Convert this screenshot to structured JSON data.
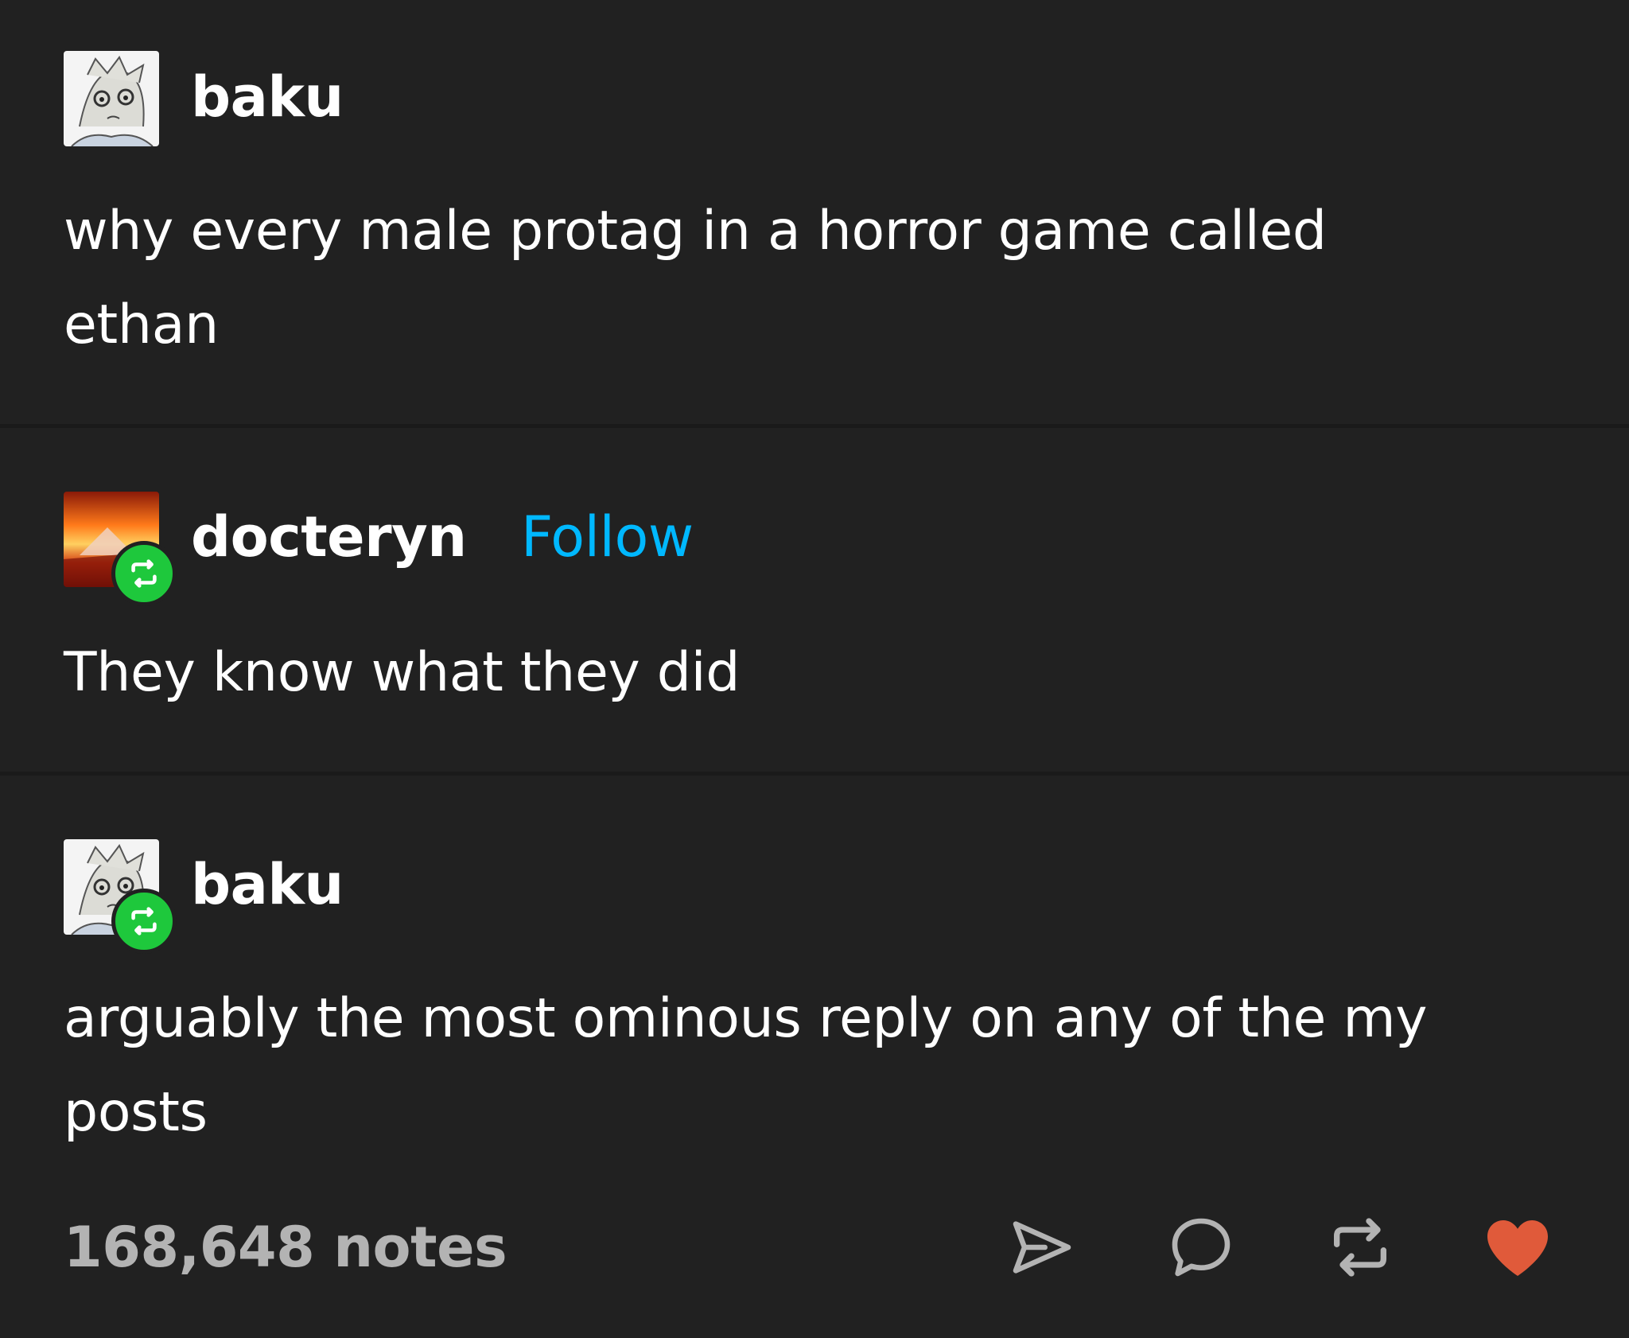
{
  "posts": [
    {
      "username": "baku",
      "text_line1": "why every male protag in a horror game called",
      "text_line2": "ethan",
      "reblogged": false
    },
    {
      "username": "docteryn",
      "follow_label": "Follow",
      "text_line1": "They know what they did",
      "reblogged": true
    },
    {
      "username": "baku",
      "text_line1": "arguably the most ominous reply on any of the my",
      "text_line2": "posts",
      "reblogged": true
    }
  ],
  "footer": {
    "notes": "168,648 notes",
    "actions": [
      "share-icon",
      "reply-icon",
      "reblog-icon",
      "like-icon"
    ]
  },
  "colors": {
    "background": "#212121",
    "follow": "#00b8ff",
    "reblog_badge": "#1ec83c",
    "like": "#e05a3a",
    "muted": "#b3b3b3"
  }
}
